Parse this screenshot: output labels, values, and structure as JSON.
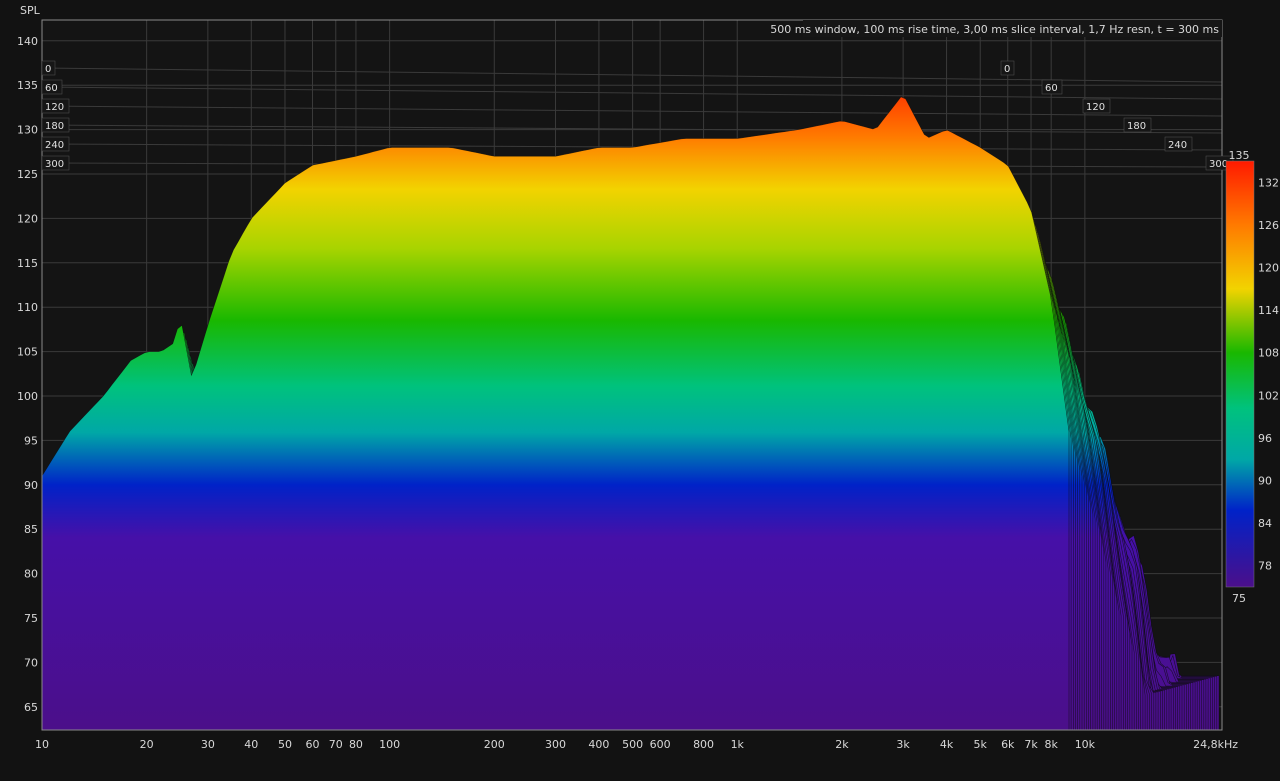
{
  "chart_data": {
    "type": "waterfall",
    "ylabel": "SPL",
    "annotation": "500 ms window, 100 ms rise time, 3,00 ms slice interval, 1,7 Hz resn, t = 300 ms",
    "x_scale": "log",
    "xlim": [
      10,
      24800
    ],
    "ylim": [
      62,
      142
    ],
    "x_ticks": [
      {
        "value": 10,
        "label": "10"
      },
      {
        "value": 20,
        "label": "20"
      },
      {
        "value": 30,
        "label": "30"
      },
      {
        "value": 40,
        "label": "40"
      },
      {
        "value": 50,
        "label": "50"
      },
      {
        "value": 60,
        "label": "60"
      },
      {
        "value": 70,
        "label": "70"
      },
      {
        "value": 80,
        "label": "80"
      },
      {
        "value": 100,
        "label": "100"
      },
      {
        "value": 200,
        "label": "200"
      },
      {
        "value": 300,
        "label": "300"
      },
      {
        "value": 400,
        "label": "400"
      },
      {
        "value": 500,
        "label": "500"
      },
      {
        "value": 600,
        "label": "600"
      },
      {
        "value": 800,
        "label": "800"
      },
      {
        "value": 1000,
        "label": "1k"
      },
      {
        "value": 2000,
        "label": "2k"
      },
      {
        "value": 3000,
        "label": "3k"
      },
      {
        "value": 4000,
        "label": "4k"
      },
      {
        "value": 5000,
        "label": "5k"
      },
      {
        "value": 6000,
        "label": "6k"
      },
      {
        "value": 7000,
        "label": "7k"
      },
      {
        "value": 8000,
        "label": "8k"
      },
      {
        "value": 10000,
        "label": "10k"
      },
      {
        "value": 24800,
        "label": "24,8kHz"
      }
    ],
    "y_ticks": [
      65,
      70,
      75,
      80,
      85,
      90,
      95,
      100,
      105,
      110,
      115,
      120,
      125,
      130,
      135,
      140
    ],
    "time_ticks": [
      "0",
      "60",
      "120",
      "180",
      "240",
      "300"
    ],
    "time_unit": "ms",
    "colorbar": {
      "min": 75,
      "max": 135,
      "ticks": [
        78,
        84,
        90,
        96,
        102,
        108,
        114,
        120,
        126,
        132
      ],
      "min_label": "75",
      "max_label": "135"
    },
    "front_slice_envelope": {
      "x_hz": [
        10,
        12,
        15,
        18,
        20,
        22,
        24,
        25,
        27,
        30,
        35,
        40,
        50,
        60,
        80,
        100,
        120,
        150,
        200,
        300,
        400,
        500,
        700,
        1000,
        1500,
        2000,
        2500,
        3000,
        3500,
        4000,
        5000,
        6000,
        7000,
        8000,
        9000
      ],
      "spl_db": [
        91,
        96,
        100,
        104,
        105,
        105,
        106,
        109,
        102,
        108,
        116,
        120,
        124,
        126,
        127,
        128,
        128,
        128,
        127,
        127,
        128,
        128,
        129,
        129,
        130,
        131,
        130,
        134,
        129,
        130,
        128,
        126,
        121,
        111,
        96
      ]
    },
    "decay_db_over_slices": 62,
    "grid": true
  }
}
